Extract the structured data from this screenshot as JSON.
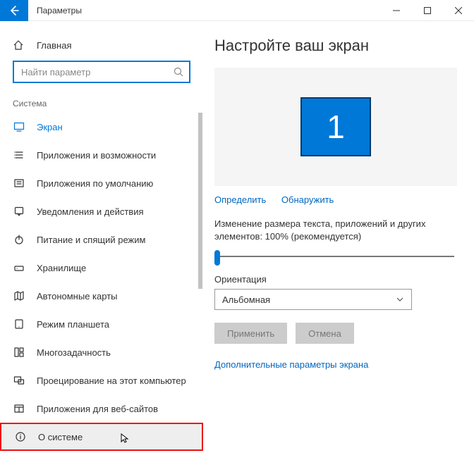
{
  "titlebar": {
    "title": "Параметры"
  },
  "home_label": "Главная",
  "search": {
    "placeholder": "Найти параметр"
  },
  "section_header": "Система",
  "menu": {
    "items": [
      {
        "name": "display",
        "label": "Экран",
        "icon": "monitor-icon",
        "selected": true
      },
      {
        "name": "apps-features",
        "label": "Приложения и возможности",
        "icon": "list-icon"
      },
      {
        "name": "default-apps",
        "label": "Приложения по умолчанию",
        "icon": "defaults-icon"
      },
      {
        "name": "notifications",
        "label": "Уведомления и действия",
        "icon": "notifications-icon"
      },
      {
        "name": "power-sleep",
        "label": "Питание и спящий режим",
        "icon": "power-icon"
      },
      {
        "name": "storage",
        "label": "Хранилище",
        "icon": "storage-icon"
      },
      {
        "name": "offline-maps",
        "label": "Автономные карты",
        "icon": "map-icon"
      },
      {
        "name": "tablet-mode",
        "label": "Режим планшета",
        "icon": "tablet-icon"
      },
      {
        "name": "multitasking",
        "label": "Многозадачность",
        "icon": "multitask-icon"
      },
      {
        "name": "projecting",
        "label": "Проецирование на этот компьютер",
        "icon": "project-icon"
      },
      {
        "name": "apps-for-websites",
        "label": "Приложения для веб-сайтов",
        "icon": "web-apps-icon"
      },
      {
        "name": "about",
        "label": "О системе",
        "icon": "info-icon",
        "highlighted": true
      }
    ]
  },
  "main": {
    "heading": "Настройте ваш экран",
    "monitors": [
      {
        "id": "1"
      }
    ],
    "identify": "Определить",
    "detect": "Обнаружить",
    "scale_label": "Изменение размера текста, приложений и других элементов: 100% (рекомендуется)",
    "orientation_label": "Ориентация",
    "orientation_value": "Альбомная",
    "apply": "Применить",
    "cancel": "Отмена",
    "advanced_link": "Дополнительные параметры экрана"
  }
}
